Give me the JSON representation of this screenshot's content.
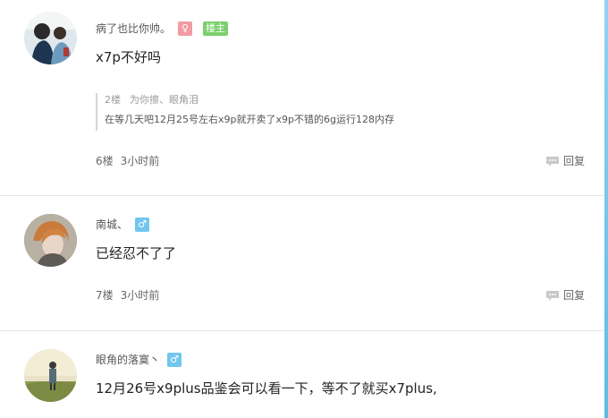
{
  "posts": [
    {
      "username": "病了也比你帅。",
      "gender_icon": "female-icon",
      "gender_glyph": "♀",
      "op_badge": "楼主",
      "content": "x7p不好吗",
      "quote": {
        "floor": "2楼",
        "author": "为你擦、眼角泪",
        "text": "在等几天吧12月25号左右x9p就开卖了x9p不错的6g运行128内存"
      },
      "floor": "6楼",
      "time": "3小时前",
      "reply_label": "回复"
    },
    {
      "username": "南城、",
      "gender_icon": "male-icon",
      "gender_glyph": "♂",
      "content": "已经忍不了了",
      "floor": "7楼",
      "time": "3小时前",
      "reply_label": "回复"
    },
    {
      "username": "眼角的落寞丶",
      "gender_icon": "male-icon",
      "gender_glyph": "♂",
      "content": "12月26号x9plus品鉴会可以看一下，等不了就买x7plus,"
    }
  ],
  "colors": {
    "accent_rail": "#5bbde6",
    "female_badge": "#f39aa4",
    "male_badge": "#72c6ee",
    "op_badge": "#7ad06b"
  }
}
